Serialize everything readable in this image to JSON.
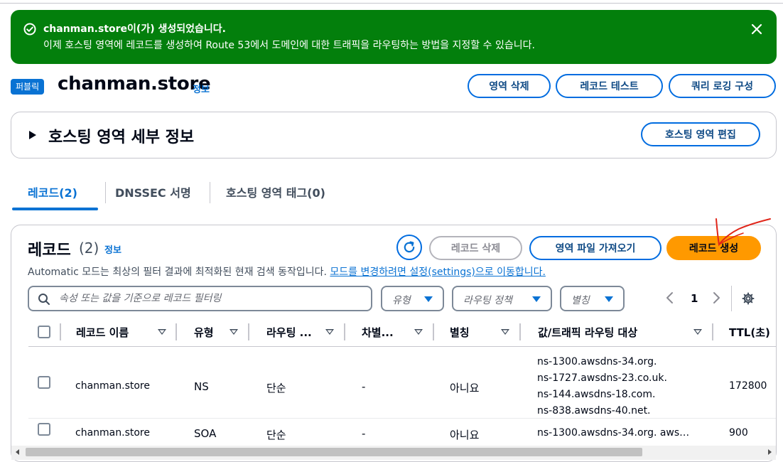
{
  "flash": {
    "title": "chanman.store이(가) 생성되었습니다.",
    "message": "이제 호스팅 영역에 레코드를 생성하여 Route 53에서 도메인에 대한 트래픽을 라우팅하는 방법을 지정할 수 있습니다.",
    "icon": "check-circle-icon",
    "close_icon": "close-icon",
    "color": "#037f0c"
  },
  "header": {
    "badge": "퍼블릭",
    "title": "chanman.store",
    "info": "정보",
    "buttons": {
      "delete_zone": "영역 삭제",
      "test_record": "레코드 테스트",
      "query_logging": "쿼리 로깅 구성"
    }
  },
  "details": {
    "title": "호스팅 영역 세부 정보",
    "edit_button": "호스팅 영역 편집"
  },
  "tabs": [
    {
      "label": "레코드(2)",
      "active": true
    },
    {
      "label": "DNSSEC 서명",
      "active": false
    },
    {
      "label": "호스팅 영역 태그(0)",
      "active": false
    }
  ],
  "records": {
    "title": "레코드",
    "count": "(2)",
    "info": "정보",
    "delete_button": "레코드 삭제",
    "import_button": "영역 파일 가져오기",
    "create_button": "레코드 생성",
    "auto_text": "Automatic 모드는 최상의 필터 결과에 최적화된 현재 검색 동작입니다.",
    "auto_link": "모드를 변경하려면 설정(settings)으로 이동합니다.",
    "search_placeholder": "속성 또는 값을 기준으로 레코드 필터링",
    "filters": {
      "type": "유형",
      "routing": "라우팅 정책",
      "alias": "별칭"
    },
    "page": "1",
    "columns": [
      "레코드 이름",
      "유형",
      "라우팅 ...",
      "차별...",
      "별칭",
      "값/트래픽 라우팅 대상",
      "TTL(초)"
    ],
    "rows": [
      {
        "name": "chanman.store",
        "type": "NS",
        "routing": "단순",
        "differentiator": "-",
        "alias": "아니요",
        "values": [
          "ns-1300.awsdns-34.org.",
          "ns-1727.awsdns-23.co.uk.",
          "ns-144.awsdns-18.com.",
          "ns-838.awsdns-40.net."
        ],
        "ttl": "172800"
      },
      {
        "name": "chanman.store",
        "type": "SOA",
        "routing": "단순",
        "differentiator": "-",
        "alias": "아니요",
        "values": [
          "ns-1300.awsdns-34.org. aws…"
        ],
        "ttl": "900"
      }
    ]
  },
  "colors": {
    "accent": "#0972d3",
    "primary_button": "#ff9900",
    "success": "#037f0c",
    "annotation": "#e0261a"
  }
}
